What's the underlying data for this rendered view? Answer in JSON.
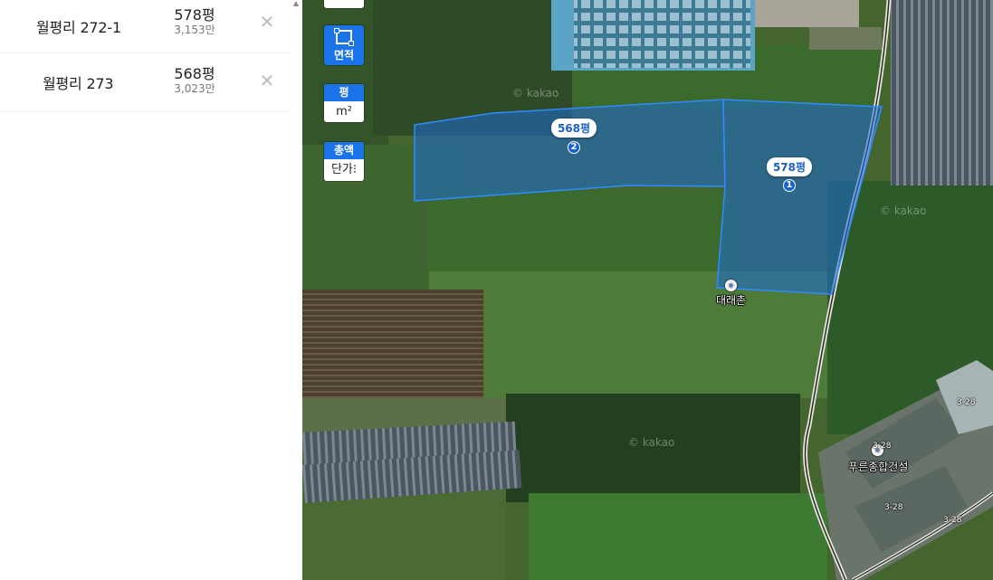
{
  "parcels": [
    {
      "name": "월평리 272-1",
      "area": "578평",
      "price": "3,153만",
      "remove_icon": "close-icon"
    },
    {
      "name": "월평리 273",
      "area": "568평",
      "price": "3,023만",
      "remove_icon": "close-icon"
    }
  ],
  "controls": {
    "area_tool": {
      "label": "면적",
      "icon": "area-select-icon"
    },
    "unit_toggle": {
      "top": "평",
      "bottom": "m²"
    },
    "price_toggle": {
      "top": "총액",
      "bottom": "단가⁝"
    }
  },
  "map": {
    "polygon_labels": [
      {
        "area": "568평",
        "number": "2"
      },
      {
        "area": "578평",
        "number": "1"
      }
    ],
    "pois": [
      {
        "name": "대래촌"
      },
      {
        "name": "푸른종합건설"
      }
    ],
    "road_labels": [
      "3-28",
      "3-28",
      "3-28",
      "3-28"
    ],
    "watermark": "© kakao",
    "colors": {
      "polygon_fill": "#1e6bd6",
      "polygon_stroke": "#2f8bff",
      "accent": "#1a73e8"
    }
  }
}
